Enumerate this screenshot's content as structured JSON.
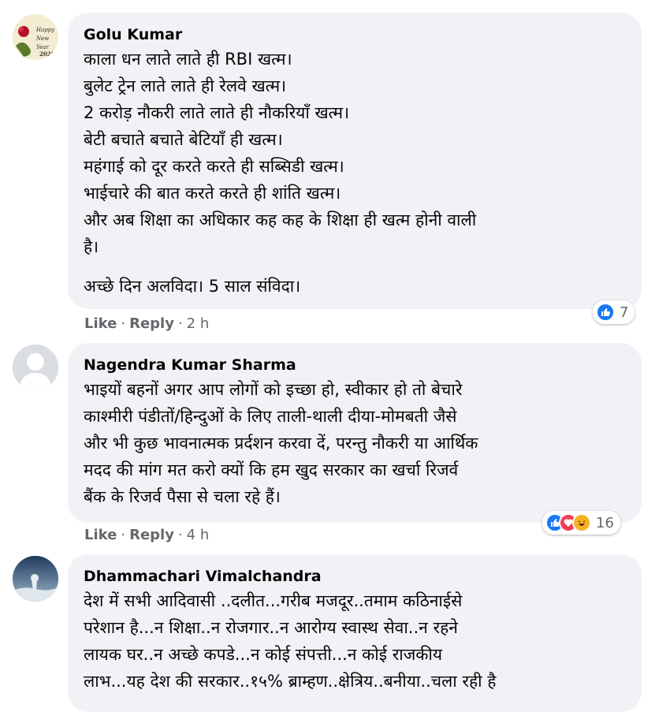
{
  "comments": [
    {
      "author": "Golu Kumar",
      "lines": [
        "काला धन लाते लाते ही RBI खत्म।",
        "बुलेट ट्रेन लाते लाते ही रेलवे खत्म।",
        "2 करोड़ नौकरी लाते लाते ही नौकरियाँ खत्म।",
        "बेटी बचाते बचाते बेटियाँ ही खत्म।",
        "महंगाई को दूर करते करते ही सब्सिडी खत्म।",
        "भाईचारे की बात करते करते ही शांति खत्म।",
        "और अब शिक्षा का अधिकार कह कह के शिक्षा ही खत्म होनी वाली",
        "है।"
      ],
      "closing": "अच्छे दिन अलविदा। 5 साल संविदा।",
      "like": "Like",
      "reply": "Reply",
      "time": "2 h",
      "reaction_count": "7",
      "reactions": [
        "like-icon"
      ]
    },
    {
      "author": "Nagendra Kumar Sharma",
      "lines": [
        "भाइयों बहनों अगर आप लोगों को इच्छा हो, स्वीकार हो तो बेचारे",
        "काश्मीरी पंडीतों/हिन्दुओं के लिए ताली-थाली दीया-मोमबती जैसे",
        "और भी कुछ भावनात्मक प्रर्दशन करवा दें, परन्तु नौकरी या आर्थिक",
        "मदद की मांग मत करो क्यों कि हम खुद सरकार का खर्चा रिजर्व",
        "बैंक के रिजर्व पैसा से चला रहे हैं।"
      ],
      "like": "Like",
      "reply": "Reply",
      "time": "4 h",
      "reaction_count": "16",
      "reactions": [
        "like-icon",
        "love-icon",
        "haha-icon"
      ]
    },
    {
      "author": "Dhammachari Vimalchandra",
      "lines": [
        "देश में सभी आदिवासी ..दलीत...गरीब मजदूर..तमाम कठिनाईसे",
        "परेशान है...न शिक्षा..न रोजगार..न आरोग्य स्वास्थ सेवा..न रहने",
        "लायक घर..न अच्छे कपडे...न कोई संपत्ती...न कोई राजकीय",
        "लाभ...यह देश की सरकार..१५% ब्राम्हण..क्षेत्रिय..बनीया..चला रही है"
      ]
    }
  ],
  "colors": {
    "bubble": "#f0f2f5",
    "meta": "#65676b",
    "like_blue": "#1877f2",
    "love_red": "#f33e58",
    "haha_yellow": "#f7b125"
  }
}
